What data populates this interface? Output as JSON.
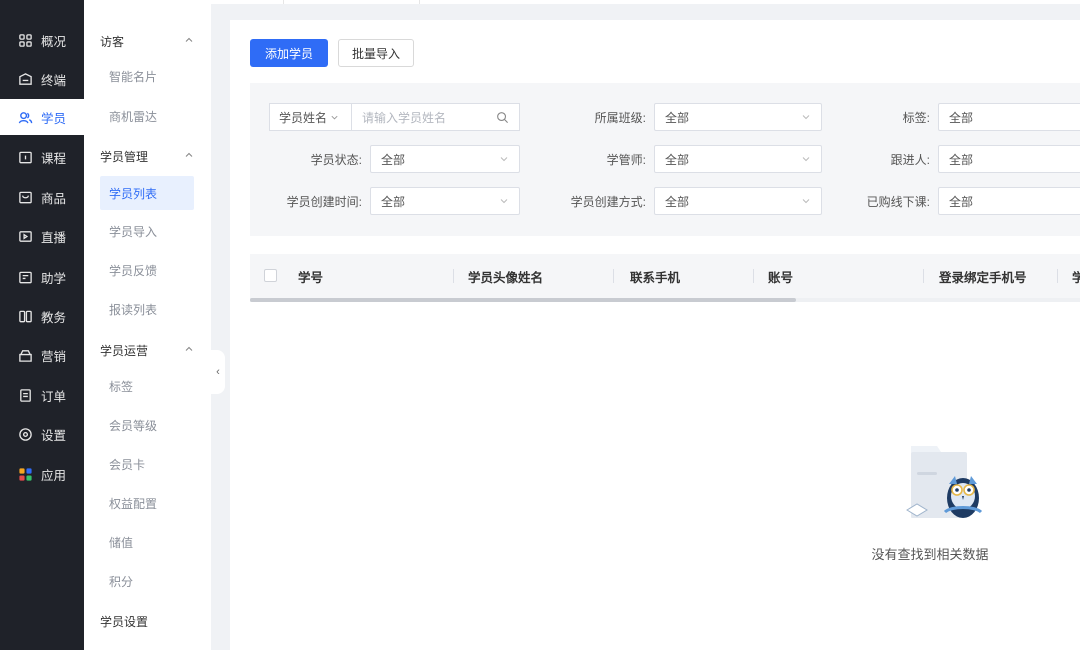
{
  "nav": {
    "items": [
      {
        "label": "概况",
        "icon": "grid-icon"
      },
      {
        "label": "终端",
        "icon": "terminal-icon"
      },
      {
        "label": "学员",
        "icon": "users-icon"
      },
      {
        "label": "课程",
        "icon": "course-icon"
      },
      {
        "label": "商品",
        "icon": "goods-icon"
      },
      {
        "label": "直播",
        "icon": "live-icon"
      },
      {
        "label": "助学",
        "icon": "study-icon"
      },
      {
        "label": "教务",
        "icon": "teaching-icon"
      },
      {
        "label": "营销",
        "icon": "marketing-icon"
      },
      {
        "label": "订单",
        "icon": "order-icon"
      },
      {
        "label": "设置",
        "icon": "settings-icon"
      },
      {
        "label": "应用",
        "icon": "apps-icon"
      }
    ],
    "active": "学员",
    "accent": "#2f6cf6"
  },
  "submenu": {
    "group_visitors": "访客",
    "item_smart_card": "智能名片",
    "item_radar": "商机雷达",
    "group_manage": "学员管理",
    "item_list": "学员列表",
    "item_import": "学员导入",
    "item_feedback": "学员反馈",
    "item_enroll": "报读列表",
    "group_ops": "学员运营",
    "item_tags": "标签",
    "item_level": "会员等级",
    "item_card": "会员卡",
    "item_rights": "权益配置",
    "item_stored": "储值",
    "item_points": "积分",
    "group_settings": "学员设置"
  },
  "toolbar": {
    "add_label": "添加学员",
    "import_label": "批量导入"
  },
  "filters": {
    "name_select": "学员姓名",
    "name_placeholder": "请输入学员姓名",
    "class_label": "所属班级:",
    "class_value": "全部",
    "tag_label": "标签:",
    "tag_value": "全部",
    "status_label": "学员状态:",
    "status_value": "全部",
    "manager_label": "学管师:",
    "manager_value": "全部",
    "follower_label": "跟进人:",
    "follower_value": "全部",
    "created_time_label": "学员创建时间:",
    "created_time_value": "全部",
    "created_method_label": "学员创建方式:",
    "created_method_value": "全部",
    "offline_label": "已购线下课:",
    "offline_value": "全部"
  },
  "table": {
    "columns": [
      "学号",
      "学员头像姓名",
      "联系手机",
      "账号",
      "登录绑定手机号",
      "学"
    ]
  },
  "empty": {
    "text": "没有查找到相关数据"
  }
}
